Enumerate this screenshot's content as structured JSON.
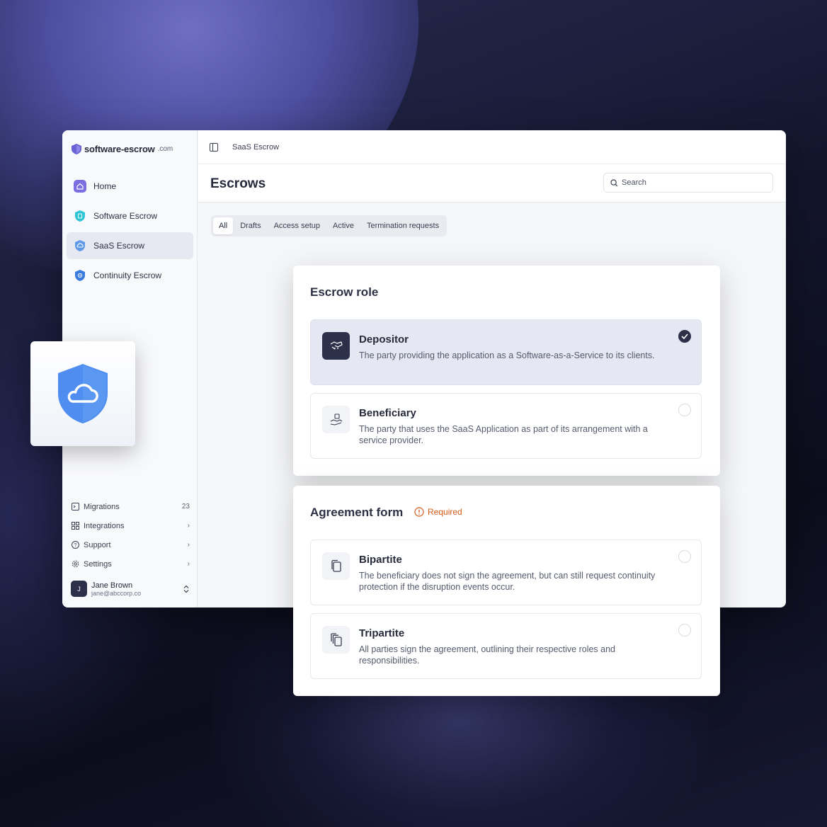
{
  "brand": {
    "name": "software-escrow",
    "suffix": ".com"
  },
  "sidebar": {
    "items": [
      {
        "label": "Home",
        "icon": "home-icon",
        "color": "#7b6ee0"
      },
      {
        "label": "Software Escrow",
        "icon": "software-shield-icon",
        "color": "#2fc4d6"
      },
      {
        "label": "SaaS Escrow",
        "icon": "cloud-shield-icon",
        "color": "#5f9ae8",
        "active": true
      },
      {
        "label": "Continuity Escrow",
        "icon": "continuity-shield-icon",
        "color": "#3a7be0"
      }
    ],
    "bottom": [
      {
        "label": "Migrations",
        "icon": "terminal-icon",
        "trailing": "23"
      },
      {
        "label": "Integrations",
        "icon": "grid-icon",
        "trailing": "›"
      },
      {
        "label": "Support",
        "icon": "help-icon",
        "trailing": "›"
      },
      {
        "label": "Settings",
        "icon": "gear-icon",
        "trailing": "›"
      }
    ],
    "user": {
      "initial": "J",
      "name": "Jane Brown",
      "email": "jane@abccorp.co"
    }
  },
  "topbar": {
    "breadcrumb": "SaaS Escrow"
  },
  "header": {
    "title": "Escrows",
    "search_placeholder": "Search"
  },
  "tabs": [
    "All",
    "Drafts",
    "Access setup",
    "Active",
    "Termination requests"
  ],
  "escrow_role": {
    "title": "Escrow role",
    "options": [
      {
        "title": "Depositor",
        "description": "The party providing the application as a Software-as-a-Service to its clients.",
        "icon": "handshake-code-icon",
        "selected": true
      },
      {
        "title": "Beneficiary",
        "description": "The party that uses the SaaS Application as part of its arrangement with a service provider.",
        "icon": "hand-receive-icon",
        "selected": false
      }
    ]
  },
  "agreement_form": {
    "title": "Agreement form",
    "required_label": "Required",
    "options": [
      {
        "title": "Bipartite",
        "description": "The beneficiary does not sign the agreement, but can still request continuity protection if the disruption events occur.",
        "icon": "copy-document-icon",
        "selected": false
      },
      {
        "title": "Tripartite",
        "description": "All parties sign the agreement, outlining their respective roles and responsibilities.",
        "icon": "stacked-documents-icon",
        "selected": false
      }
    ]
  },
  "colors": {
    "accent": "#2c3048",
    "required": "#d35a16",
    "shield": "#4f8ef0"
  }
}
